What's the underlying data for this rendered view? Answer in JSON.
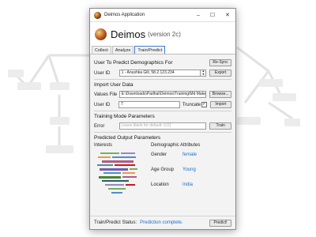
{
  "window": {
    "title": "Deimos Application",
    "minimize": "–",
    "maximize": "☐",
    "close": "✕"
  },
  "header": {
    "app_name": "Deimos",
    "version": "(version 2c)"
  },
  "tabs": [
    {
      "label": "Collect"
    },
    {
      "label": "Analyze"
    },
    {
      "label": "Train/Predict"
    }
  ],
  "predict_section": {
    "title": "User To Predict Demographics For",
    "resync_label": "Re-Sync",
    "user_id_label": "User ID",
    "user_id_value": "1 - Anushka Gill, 58.2.123.234",
    "export_label": "Export"
  },
  "import_section": {
    "title": "Import User Data",
    "values_file_label": "Values File",
    "values_file_value": "E:\\Downloads\\Padhai\\Deimos\\Training\\Md Maketop",
    "browse_label": "Browse...",
    "user_id_label": "User ID",
    "user_id_value": "7",
    "truncate_label": "Truncate",
    "truncate_checked": "✓",
    "import_label": "Import"
  },
  "training_section": {
    "title": "Training Mode Parameters",
    "error_label": "Error",
    "error_placeholder": "Leave blank for default: 0.01",
    "train_label": "Train"
  },
  "output_section": {
    "title": "Predicted Output Parameters",
    "interests_label": "Interests",
    "demographics_label": "Demographic Attributes",
    "attributes": [
      {
        "name": "Gender",
        "value": "female"
      },
      {
        "name": "Age Group",
        "value": "Young"
      },
      {
        "name": "Location",
        "value": "India"
      }
    ]
  },
  "status": {
    "label": "Train/Predict Status:",
    "value": "Prediction complete.",
    "predict_label": "Predict!"
  },
  "colors": {
    "accent": "#1a6fd1",
    "tab_active_border": "#3c7fd0"
  },
  "icons": {
    "app": "deimos-planet-icon",
    "logo": "deimos-logo-icon"
  }
}
